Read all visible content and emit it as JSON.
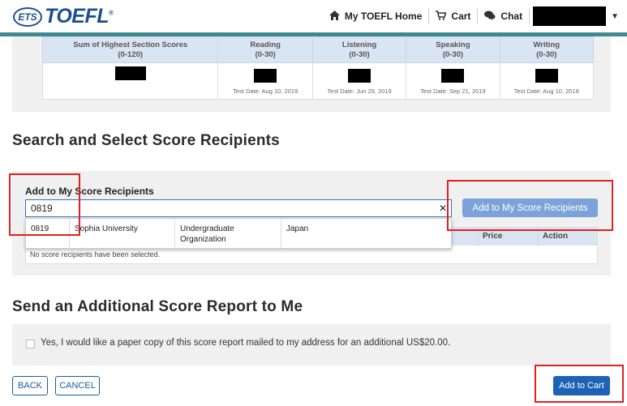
{
  "header": {
    "logo_ets": "ETS",
    "logo_toefl": "TOEFL",
    "logo_reg": "®",
    "nav": [
      {
        "label": "My TOEFL Home",
        "icon": "home-icon",
        "glyph": "🏠"
      },
      {
        "label": "Cart",
        "icon": "cart-icon",
        "glyph": "🛒"
      },
      {
        "label": "Chat",
        "icon": "chat-icon",
        "glyph": "💬"
      }
    ],
    "user_caret": "▼"
  },
  "scores": {
    "columns": [
      {
        "title": "Sum of Highest Section Scores",
        "range": "(0-120)",
        "test_date": ""
      },
      {
        "title": "Reading",
        "range": "(0-30)",
        "test_date": "Test Date: Aug 10, 2019"
      },
      {
        "title": "Listening",
        "range": "(0-30)",
        "test_date": "Test Date: Jun 29, 2019"
      },
      {
        "title": "Speaking",
        "range": "(0-30)",
        "test_date": "Test Date: Sep 21, 2019"
      },
      {
        "title": "Writing",
        "range": "(0-30)",
        "test_date": "Test Date: Aug 10, 2019"
      }
    ]
  },
  "recipients": {
    "section_title": "Search and Select Score Recipients",
    "label": "Add to My Score Recipients",
    "search_value": "0819",
    "clear_glyph": "✕",
    "add_button": "Add to My Score Recipients",
    "table_headers": {
      "price": "Price",
      "action": "Action"
    },
    "empty_text": "No score recipients have been selected.",
    "suggestion": {
      "code": "0819",
      "name": "Sophia University",
      "type_line1": "Undergraduate",
      "type_line2": "Organization",
      "country": "Japan"
    }
  },
  "paper": {
    "section_title": "Send an Additional Score Report to Me",
    "checkbox_label": "Yes, I would like a paper copy of this score report mailed to my address for an additional US$20.00.",
    "checked": false
  },
  "footer": {
    "back": "BACK",
    "cancel": "CANCEL",
    "add_to_cart": "Add to Cart"
  },
  "colors": {
    "brand": "#1d4f91",
    "teal": "#3f8a91",
    "primary_button": "#1d62b5",
    "disabled_button": "#7ba3d9",
    "highlight": "#e02020"
  }
}
